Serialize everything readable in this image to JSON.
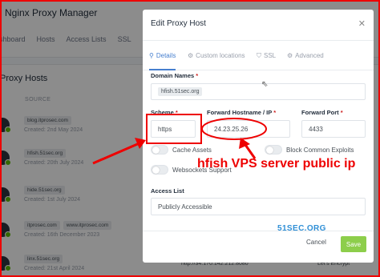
{
  "app": {
    "title": "Nginx Proxy Manager",
    "nav": [
      "ashboard",
      "Hosts",
      "Access Lists",
      "SSL"
    ],
    "card_title": "Proxy Hosts",
    "col_source": "SOURCE",
    "rows": [
      {
        "tags": [
          "blog.itprosec.com"
        ],
        "created": "Created: 2nd May 2024"
      },
      {
        "tags": [
          "hfish.51sec.org"
        ],
        "created": "Created: 20th July 2024"
      },
      {
        "tags": [
          "hide.51sec.org"
        ],
        "created": "Created: 1st July 2024"
      },
      {
        "tags": [
          "itprosec.com",
          "www.itprosec.com"
        ],
        "created": "Created: 16th December 2023"
      },
      {
        "tags": [
          "linx.51sec.org"
        ],
        "created": "Created: 21st April 2024"
      }
    ],
    "bottom_destination": "http://34.170.142.212:8080",
    "bottom_ssl": "Let's Encrypt"
  },
  "modal": {
    "title": "Edit Proxy Host",
    "close_glyph": "✕",
    "tabs": [
      {
        "icon": "⚲",
        "label": "Details",
        "active": true
      },
      {
        "icon": "⚙",
        "label": "Custom locations",
        "active": false
      },
      {
        "icon": "⛉",
        "label": "SSL",
        "active": false
      },
      {
        "icon": "⚙",
        "label": "Advanced",
        "active": false
      }
    ],
    "domain_label": "Domain Names",
    "domain_value": "hfish.51sec.org",
    "scheme_label": "Scheme",
    "scheme_value": "https",
    "host_label": "Forward Hostname / IP",
    "host_value": "24.23.25.26",
    "port_label": "Forward Port",
    "port_value": "4433",
    "toggles": {
      "cache": "Cache Assets",
      "block": "Block Common Exploits",
      "websocket": "Websockets Support"
    },
    "access_label": "Access List",
    "access_value": "Publicly Accessible",
    "cancel": "Cancel",
    "save": "Save",
    "required_mark": "*"
  },
  "annotation": {
    "caption": "hfish VPS server public ip",
    "watermark": "51SEC.ORG",
    "color": "#e00000"
  }
}
